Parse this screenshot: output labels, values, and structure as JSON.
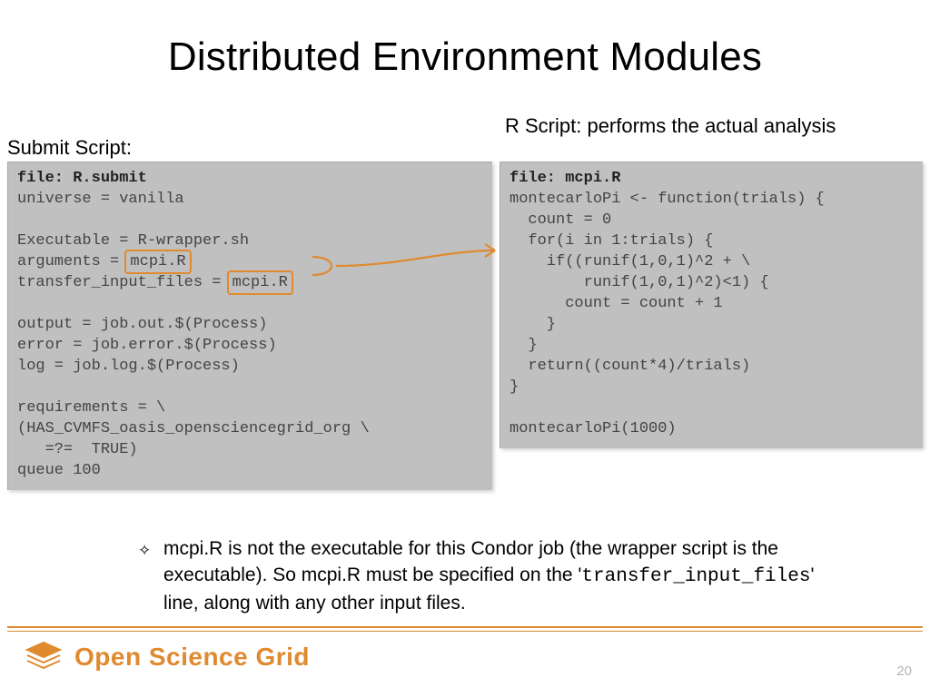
{
  "title": "Distributed Environment Modules",
  "labels": {
    "submit": "Submit Script:",
    "rscript": "R Script: performs the actual analysis"
  },
  "code": {
    "left_file": "file: R.submit",
    "left_l1": "universe = vanilla",
    "left_l2": "",
    "left_l3": "Executable = R-wrapper.sh",
    "left_l4a": "arguments = ",
    "left_l4b": "mcpi.R",
    "left_l5a": "transfer_input_files = ",
    "left_l5b": "mcpi.R",
    "left_l6": "",
    "left_l7": "output = job.out.$(Process)",
    "left_l8": "error = job.error.$(Process)",
    "left_l9": "log = job.log.$(Process)",
    "left_l10": "",
    "left_l11": "requirements = \\",
    "left_l12": "(HAS_CVMFS_oasis_opensciencegrid_org \\",
    "left_l13": "   =?=  TRUE)",
    "left_l14": "queue 100",
    "right_file": "file: mcpi.R",
    "right_l1": "montecarloPi <- function(trials) {",
    "right_l2": "  count = 0",
    "right_l3": "  for(i in 1:trials) {",
    "right_l4": "    if((runif(1,0,1)^2 + \\",
    "right_l5": "        runif(1,0,1)^2)<1) {",
    "right_l6": "      count = count + 1",
    "right_l7": "    }",
    "right_l8": "  }",
    "right_l9": "  return((count*4)/trials)",
    "right_l10": "}",
    "right_l11": "",
    "right_l12": "montecarloPi(1000)"
  },
  "note": {
    "bullet": "✧",
    "t1": "mcpi.R is not the executable for this Condor job (the wrapper script is the executable).  So mcpi.R must be specified on the '",
    "mono": "transfer_input_files",
    "t2": "' line, along with any other input files."
  },
  "brand": "Open Science Grid",
  "page": "20"
}
